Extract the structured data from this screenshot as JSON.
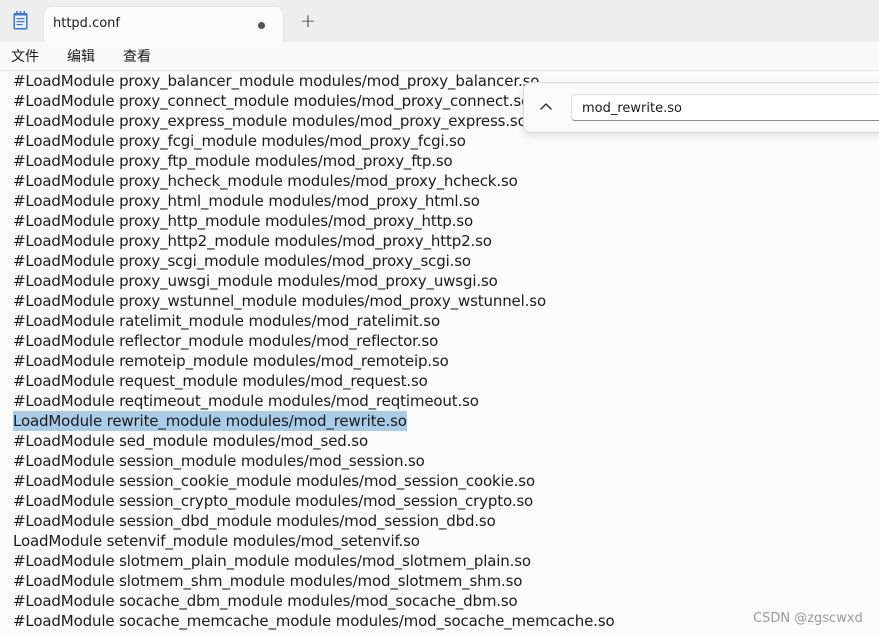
{
  "tab": {
    "title": "httpd.conf"
  },
  "menu": {
    "file": "文件",
    "edit": "编辑",
    "view": "查看"
  },
  "find": {
    "query": "mod_rewrite.so"
  },
  "editor": {
    "lines": [
      "#LoadModule proxy_balancer_module modules/mod_proxy_balancer.so",
      "#LoadModule proxy_connect_module modules/mod_proxy_connect.so",
      "#LoadModule proxy_express_module modules/mod_proxy_express.so",
      "#LoadModule proxy_fcgi_module modules/mod_proxy_fcgi.so",
      "#LoadModule proxy_ftp_module modules/mod_proxy_ftp.so",
      "#LoadModule proxy_hcheck_module modules/mod_proxy_hcheck.so",
      "#LoadModule proxy_html_module modules/mod_proxy_html.so",
      "#LoadModule proxy_http_module modules/mod_proxy_http.so",
      "#LoadModule proxy_http2_module modules/mod_proxy_http2.so",
      "#LoadModule proxy_scgi_module modules/mod_proxy_scgi.so",
      "#LoadModule proxy_uwsgi_module modules/mod_proxy_uwsgi.so",
      "#LoadModule proxy_wstunnel_module modules/mod_proxy_wstunnel.so",
      "#LoadModule ratelimit_module modules/mod_ratelimit.so",
      "#LoadModule reflector_module modules/mod_reflector.so",
      "#LoadModule remoteip_module modules/mod_remoteip.so",
      "#LoadModule request_module modules/mod_request.so",
      "#LoadModule reqtimeout_module modules/mod_reqtimeout.so",
      "LoadModule rewrite_module modules/mod_rewrite.so",
      "#LoadModule sed_module modules/mod_sed.so",
      "#LoadModule session_module modules/mod_session.so",
      "#LoadModule session_cookie_module modules/mod_session_cookie.so",
      "#LoadModule session_crypto_module modules/mod_session_crypto.so",
      "#LoadModule session_dbd_module modules/mod_session_dbd.so",
      "LoadModule setenvif_module modules/mod_setenvif.so",
      "#LoadModule slotmem_plain_module modules/mod_slotmem_plain.so",
      "#LoadModule slotmem_shm_module modules/mod_slotmem_shm.so",
      "#LoadModule socache_dbm_module modules/mod_socache_dbm.so",
      "#LoadModule socache_memcache_module modules/mod_socache_memcache.so"
    ],
    "selected_index": 17
  },
  "watermark": "CSDN @zgscwxd",
  "colors": {
    "selection": "#a9cde9",
    "background": "#fbfbfb",
    "titlebar": "#eeeeee"
  }
}
